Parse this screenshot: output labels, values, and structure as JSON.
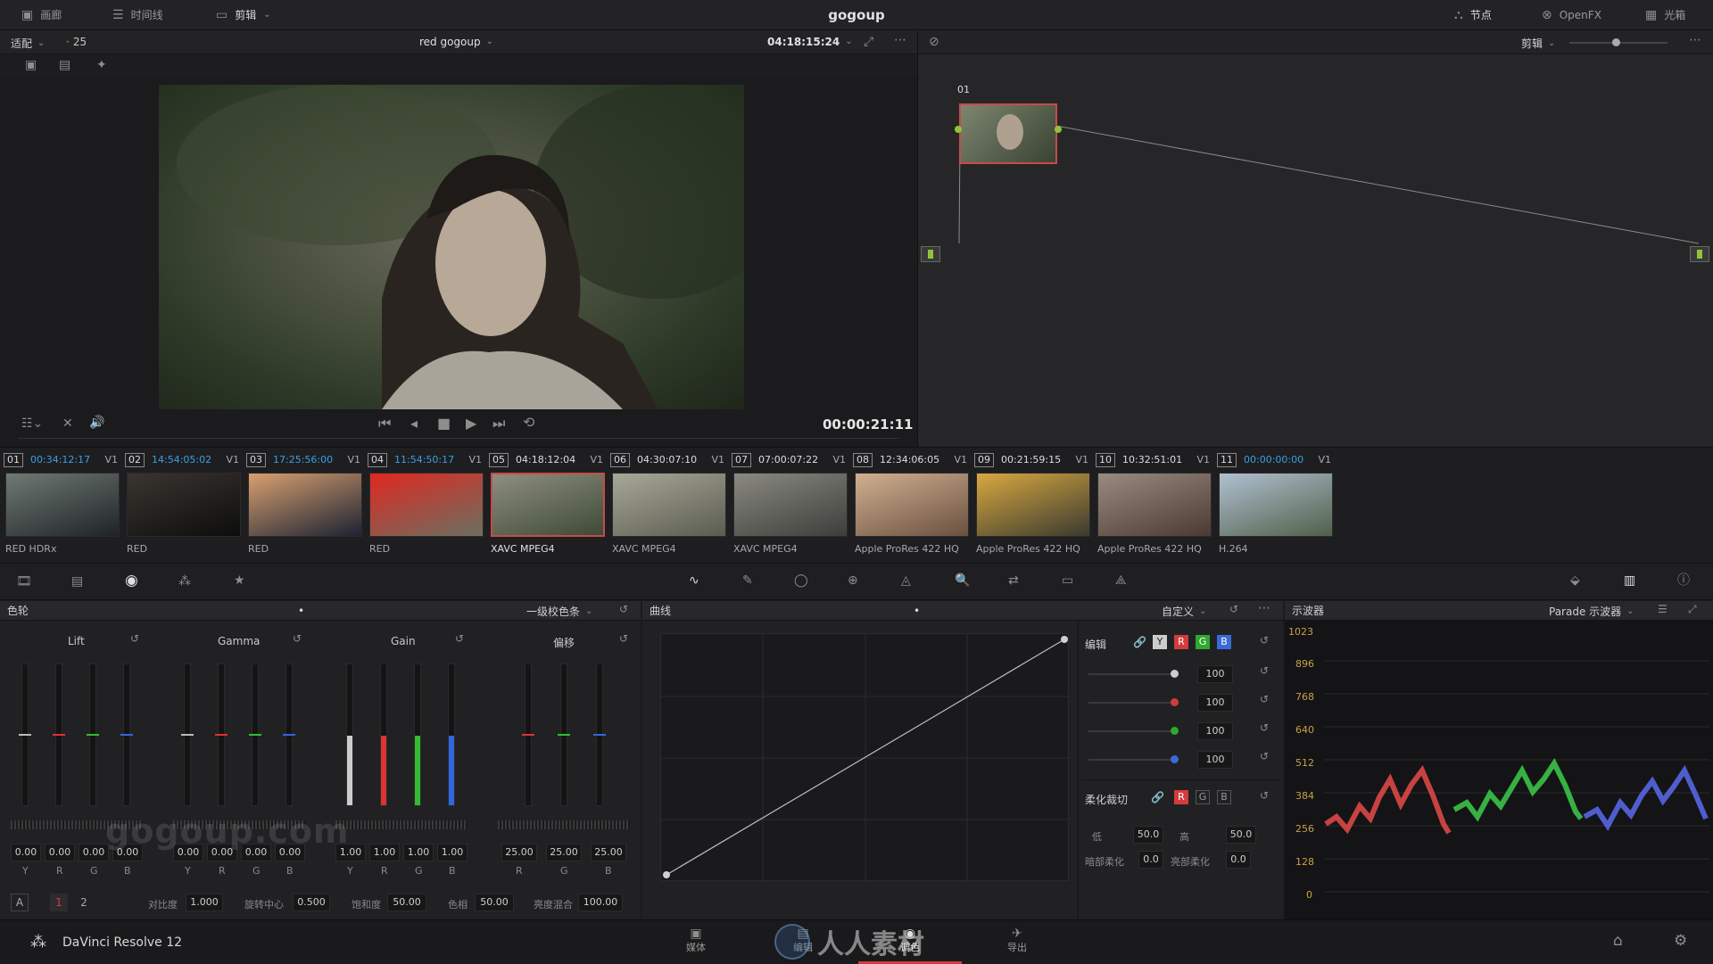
{
  "topbar": {
    "left_buttons": [
      "画廊",
      "时间线",
      "剪辑"
    ],
    "title": "gogoup",
    "right_buttons": [
      "节点",
      "OpenFX",
      "光箱"
    ]
  },
  "viewer": {
    "fit_label": "适配",
    "zoom_value": "25",
    "clip_name": "red gogoup",
    "timecode": "04:18:15:24",
    "playhead_timecode": "00:00:21:11"
  },
  "nodes": {
    "mode_label": "剪辑",
    "node_label": "01"
  },
  "clips": [
    {
      "num": "01",
      "tc": "00:34:12:17",
      "blue": true,
      "track": "V1",
      "codec": "RED HDRx",
      "c1": "#6f7a74",
      "c2": "#1f2326"
    },
    {
      "num": "02",
      "tc": "14:54:05:02",
      "blue": true,
      "track": "V1",
      "codec": "RED",
      "c1": "#3a3530",
      "c2": "#0d0d0d"
    },
    {
      "num": "03",
      "tc": "17:25:56:00",
      "blue": true,
      "track": "V1",
      "codec": "RED",
      "c1": "#d8a070",
      "c2": "#1c2233"
    },
    {
      "num": "04",
      "tc": "11:54:50:17",
      "blue": true,
      "track": "V1",
      "codec": "RED",
      "c1": "#e02820",
      "c2": "#6a7060"
    },
    {
      "num": "05",
      "tc": "04:18:12:04",
      "blue": false,
      "track": "V1",
      "codec": "XAVC MPEG4",
      "c1": "#8e8e80",
      "c2": "#3e4a36",
      "selected": true
    },
    {
      "num": "06",
      "tc": "04:30:07:10",
      "blue": false,
      "track": "V1",
      "codec": "XAVC MPEG4",
      "c1": "#a8a898",
      "c2": "#5a5c50"
    },
    {
      "num": "07",
      "tc": "07:00:07:22",
      "blue": false,
      "track": "V1",
      "codec": "XAVC MPEG4",
      "c1": "#8a8a82",
      "c2": "#3d3d3a"
    },
    {
      "num": "08",
      "tc": "12:34:06:05",
      "blue": false,
      "track": "V1",
      "codec": "Apple ProRes 422 HQ",
      "c1": "#d0b090",
      "c2": "#6a5040"
    },
    {
      "num": "09",
      "tc": "00:21:59:15",
      "blue": false,
      "track": "V1",
      "codec": "Apple ProRes 422 HQ",
      "c1": "#d8a840",
      "c2": "#3a3a30"
    },
    {
      "num": "10",
      "tc": "10:32:51:01",
      "blue": false,
      "track": "V1",
      "codec": "Apple ProRes 422 HQ",
      "c1": "#9a8a80",
      "c2": "#4a3a32"
    },
    {
      "num": "11",
      "tc": "00:00:00:00",
      "blue": true,
      "track": "V1",
      "codec": "H.264",
      "c1": "#b0c0d0",
      "c2": "#50604a"
    }
  ],
  "colorwheels": {
    "title": "色轮",
    "mode": "一级校色条",
    "groups": [
      {
        "name": "Lift",
        "values": [
          "0.00",
          "0.00",
          "0.00",
          "0.00"
        ],
        "channels": [
          "Y",
          "R",
          "G",
          "B"
        ]
      },
      {
        "name": "Gamma",
        "values": [
          "0.00",
          "0.00",
          "0.00",
          "0.00"
        ],
        "channels": [
          "Y",
          "R",
          "G",
          "B"
        ]
      },
      {
        "name": "Gain",
        "values": [
          "1.00",
          "1.00",
          "1.00",
          "1.00"
        ],
        "channels": [
          "Y",
          "R",
          "G",
          "B"
        ]
      },
      {
        "name": "偏移",
        "values": [
          "25.00",
          "25.00",
          "25.00"
        ],
        "channels": [
          "R",
          "G",
          "B"
        ]
      }
    ],
    "footer": {
      "mode_a": "A",
      "page1": "1",
      "page2": "2",
      "contrast_label": "对比度",
      "contrast": "1.000",
      "pivot_label": "旋转中心",
      "pivot": "0.500",
      "sat_label": "饱和度",
      "sat": "50.00",
      "hue_label": "色相",
      "hue": "50.00",
      "lummix_label": "亮度混合",
      "lummix": "100.00"
    }
  },
  "curves": {
    "title": "曲线",
    "preset": "自定义",
    "edit_label": "编辑",
    "channel_buttons": [
      "Y",
      "R",
      "G",
      "B"
    ],
    "intensity": [
      "100",
      "100",
      "100",
      "100"
    ],
    "soft_clip_label": "柔化裁切",
    "soft_buttons": [
      "R",
      "G",
      "B"
    ],
    "low_label": "低",
    "low": "50.0",
    "high_label": "高",
    "high": "50.0",
    "low_soft_label": "暗部柔化",
    "low_soft": "0.0",
    "high_soft_label": "亮部柔化",
    "high_soft": "0.0"
  },
  "scope": {
    "title": "示波器",
    "type": "Parade 示波器",
    "ticks": [
      "1023",
      "896",
      "768",
      "640",
      "512",
      "384",
      "256",
      "128",
      "0"
    ]
  },
  "bottombar": {
    "app_name": "DaVinci Resolve 12",
    "pages": [
      "媒体",
      "编辑",
      "调色",
      "导出"
    ],
    "active_page": "调色",
    "watermark": "人人素材",
    "watermark_left": "gogoup.com"
  },
  "colors": {
    "accent_red": "#d23c3c",
    "node_green": "#8fc43a",
    "timecode_blue": "#3aa0e0"
  }
}
